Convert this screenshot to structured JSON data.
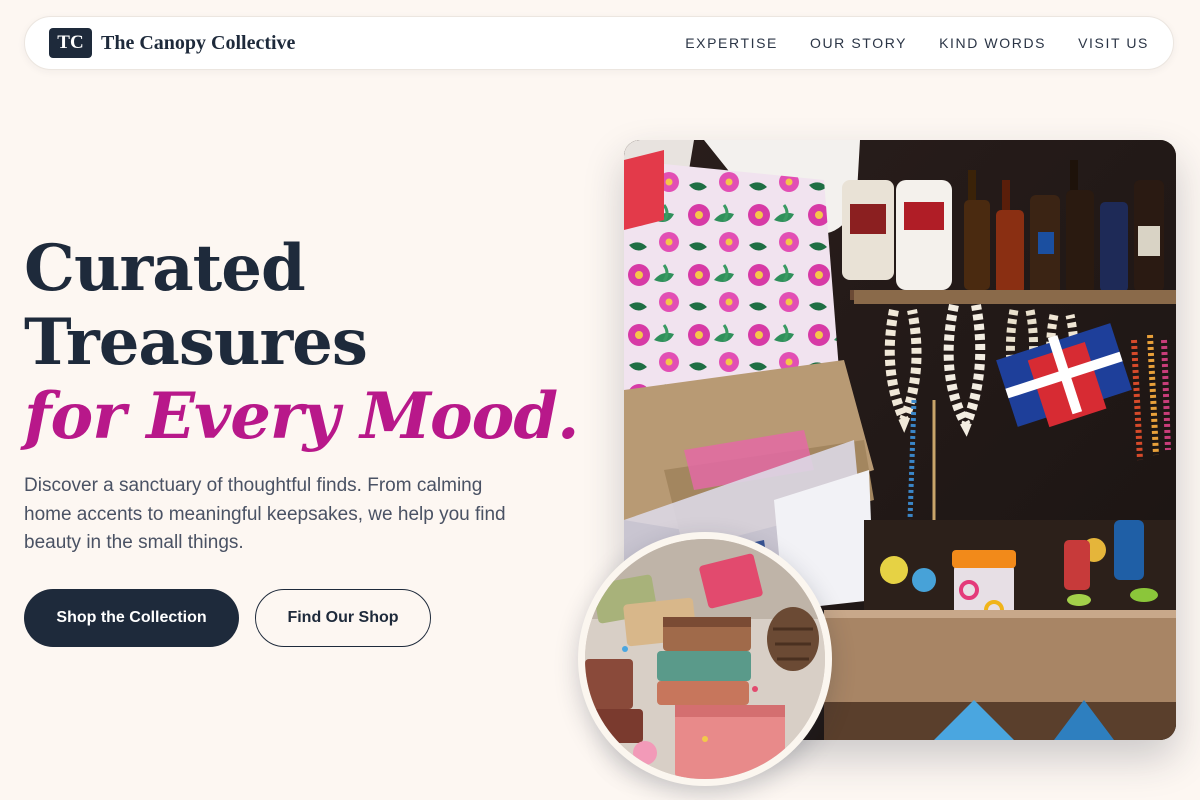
{
  "header": {
    "logo_text": "TC",
    "brand_name": "The Canopy Collective",
    "nav": [
      {
        "label": "EXPERTISE"
      },
      {
        "label": "OUR STORY"
      },
      {
        "label": "KIND WORDS"
      },
      {
        "label": "VISIT US"
      }
    ]
  },
  "hero": {
    "title_line1": "Curated",
    "title_line2": "Treasures",
    "title_accent": "for Every Mood.",
    "description": "Discover a sanctuary of thoughtful finds. From calming home accents to meaningful keepsakes, we help you find beauty in the small things.",
    "primary_button": "Shop the Collection",
    "secondary_button": "Find Our Shop"
  },
  "colors": {
    "background": "#fdf7f2",
    "navy": "#1e2a3b",
    "accent": "#b8188a"
  }
}
